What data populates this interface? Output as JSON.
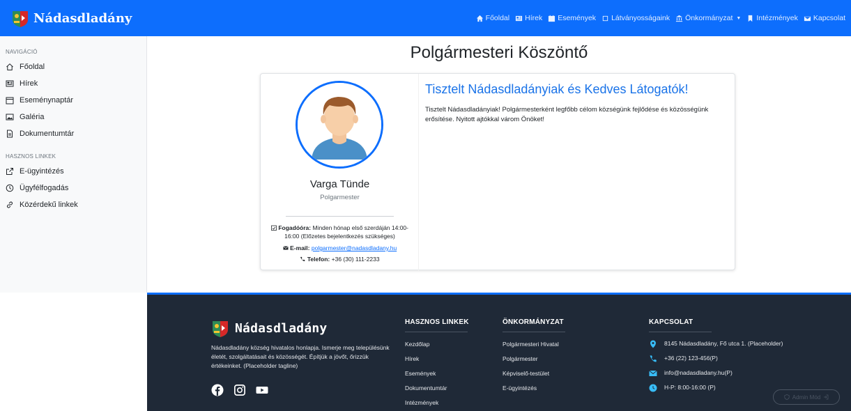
{
  "brand": {
    "name": "Nádasdladány"
  },
  "navbar": {
    "links": [
      {
        "label": "Főoldal",
        "icon": "home-icon"
      },
      {
        "label": "Hírek",
        "icon": "newspaper-icon"
      },
      {
        "label": "Események",
        "icon": "calendar-icon"
      },
      {
        "label": "Látványosságaink",
        "icon": "landmark-icon"
      },
      {
        "label": "Önkormányzat",
        "icon": "bank-icon"
      },
      {
        "label": "Intézmények",
        "icon": "bookmark-icon"
      },
      {
        "label": "Kapcsolat",
        "icon": "envelope-icon"
      }
    ]
  },
  "sidebar": {
    "nav_heading": "NAVIGÁCIÓ",
    "nav_items": [
      {
        "label": "Főoldal",
        "icon": "home-icon"
      },
      {
        "label": "Hírek",
        "icon": "newspaper-icon"
      },
      {
        "label": "Eseménynaptár",
        "icon": "calendar-icon"
      },
      {
        "label": "Galéria",
        "icon": "image-icon"
      },
      {
        "label": "Dokumentumtár",
        "icon": "file-icon"
      }
    ],
    "links_heading": "HASZNOS LINKEK",
    "link_items": [
      {
        "label": "E-ügyintézés",
        "icon": "external-link-icon"
      },
      {
        "label": "Ügyfélfogadás",
        "icon": "clock-icon"
      },
      {
        "label": "Közérdekű linkek",
        "icon": "link-icon"
      }
    ]
  },
  "main": {
    "title": "Polgármesteri Köszöntő",
    "person": {
      "name": "Varga Tünde",
      "role": "Polgarmester",
      "office_hours_label": "Fogadóóra:",
      "office_hours_value": "Minden hónap első szerdáján 14:00-16:00 (Előzetes bejelentkezés szükséges)",
      "email_label": "E-mail:",
      "email_value": "polgarmester@nadasdladany.hu",
      "phone_label": "Telefon:",
      "phone_value": "+36 (30) 111-2233"
    },
    "welcome_title": "Tisztelt Nádasdladányiak és Kedves Látogatók!",
    "welcome_text": "Tisztelt Nádasdladányiak! Polgármesterként legfőbb célom községünk fejlődése és közösségünk erősítése. Nyitott ajtókkal várom Önöket!"
  },
  "footer": {
    "brand": "Nádasdladány",
    "tagline": "Nádasdladány község hivatalos honlapja. Ismerje meg településünk életét, szolgáltatásait és közösségét. Építjük a jövőt, őrizzük értékeinket. (Placeholder tagline)",
    "columns": [
      {
        "title": "HASZNOS LINKEK",
        "links": [
          "Kezdőlap",
          "Hírek",
          "Események",
          "Dokumentumtár",
          "Intézmények"
        ]
      },
      {
        "title": "ÖNKORMÁNYZAT",
        "links": [
          "Polgármesteri Hivatal",
          "Polgármester",
          "Képviselő-testület",
          "E-ügyintézés"
        ]
      }
    ],
    "contact_title": "KAPCSOLAT",
    "contact": {
      "address": "8145 Nádasdladány, Fő utca 1. (Placeholder)",
      "phone": "+36 (22) 123-456(P)",
      "email": "info@nadasdladany.hu(P)",
      "hours": "H-P: 8:00-16:00 (P)"
    },
    "admin_label": "Admin Mód"
  },
  "colors": {
    "primary": "#0d6efd",
    "footer_bg": "#1f2937",
    "link_blue": "#1a73e8"
  }
}
